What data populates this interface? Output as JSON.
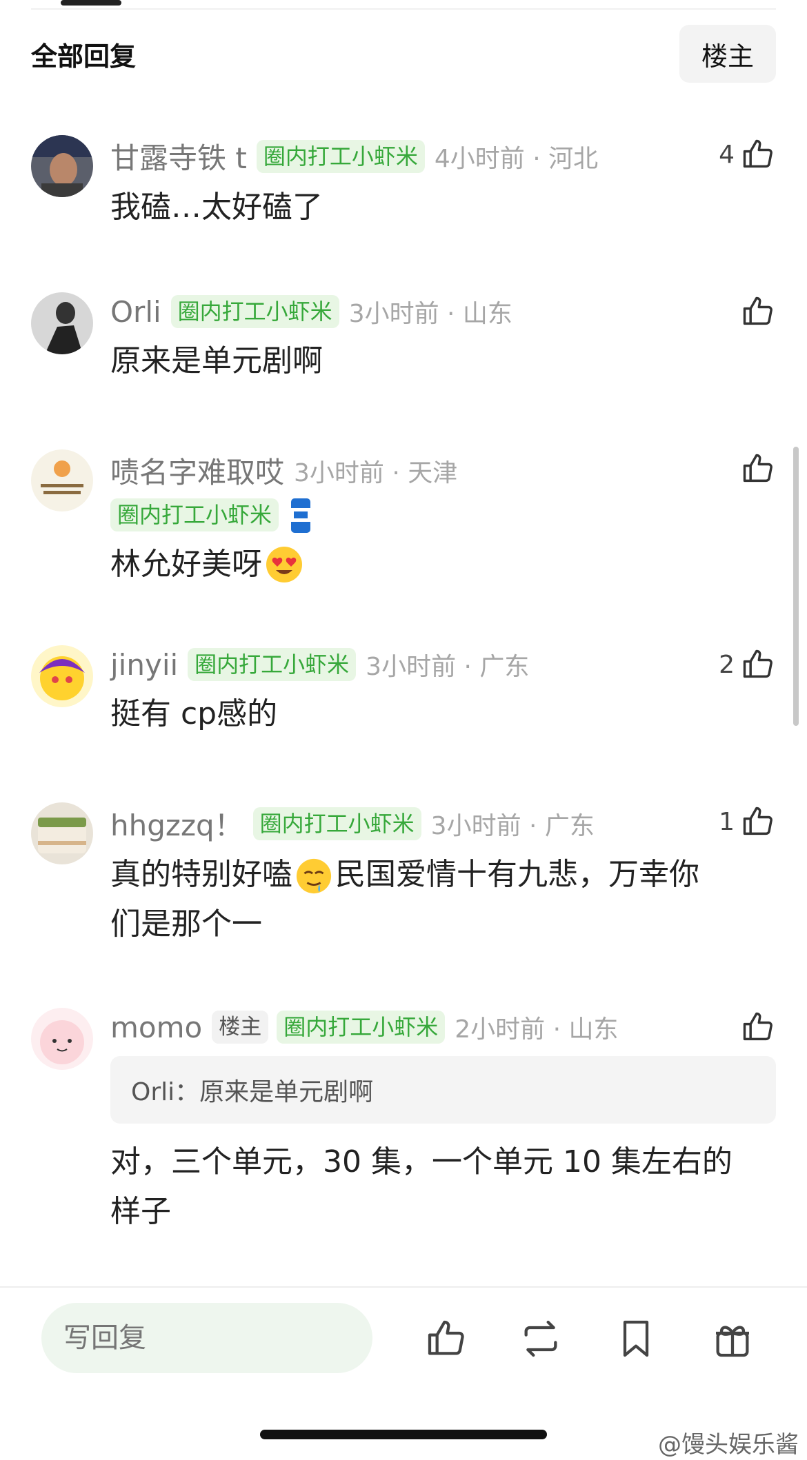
{
  "header": {
    "title": "全部回复",
    "op_button": "楼主"
  },
  "comments": [
    {
      "username": "甘露寺铁 t",
      "badge": "圈内打工小虾米",
      "time": "4小时前 · 河北",
      "content": "我磕…太好磕了",
      "likes": "4"
    },
    {
      "username": "Orli",
      "badge": "圈内打工小虾米",
      "time": "3小时前 · 山东",
      "content": "原来是单元剧啊",
      "likes": ""
    },
    {
      "username": "啧名字难取哎",
      "badge": "圈内打工小虾米",
      "time": "3小时前 · 天津",
      "content": "林允好美呀",
      "likes": ""
    },
    {
      "username": "jinyii",
      "badge": "圈内打工小虾米",
      "time": "3小时前 · 广东",
      "content": "挺有 cp感的",
      "likes": "2"
    },
    {
      "username": "hhgzzq！",
      "badge": "圈内打工小虾米",
      "time": "3小时前 · 广东",
      "content_a": "真的特别好嗑",
      "content_b": "民国爱情十有九悲，万幸你",
      "content_c": "们是那个一",
      "likes": "1"
    },
    {
      "username": "momo",
      "op_tag": "楼主",
      "badge": "圈内打工小虾米",
      "time": "2小时前 · 山东",
      "quote": "Orli：原来是单元剧啊",
      "content_a": "对，三个单元，30 集，一个单元 10 集左右的",
      "content_b": "样子",
      "likes": ""
    }
  ],
  "bottom_bar": {
    "reply_placeholder": "写回复"
  },
  "watermark": "@馒头娱乐酱",
  "icons": {
    "like": "thumbs-up-icon",
    "repost": "repost-icon",
    "bookmark": "bookmark-icon",
    "gift": "gift-icon"
  },
  "colors": {
    "badge_bg": "#e8f6e4",
    "badge_text": "#36a83a",
    "input_bg": "#eef6ee"
  }
}
